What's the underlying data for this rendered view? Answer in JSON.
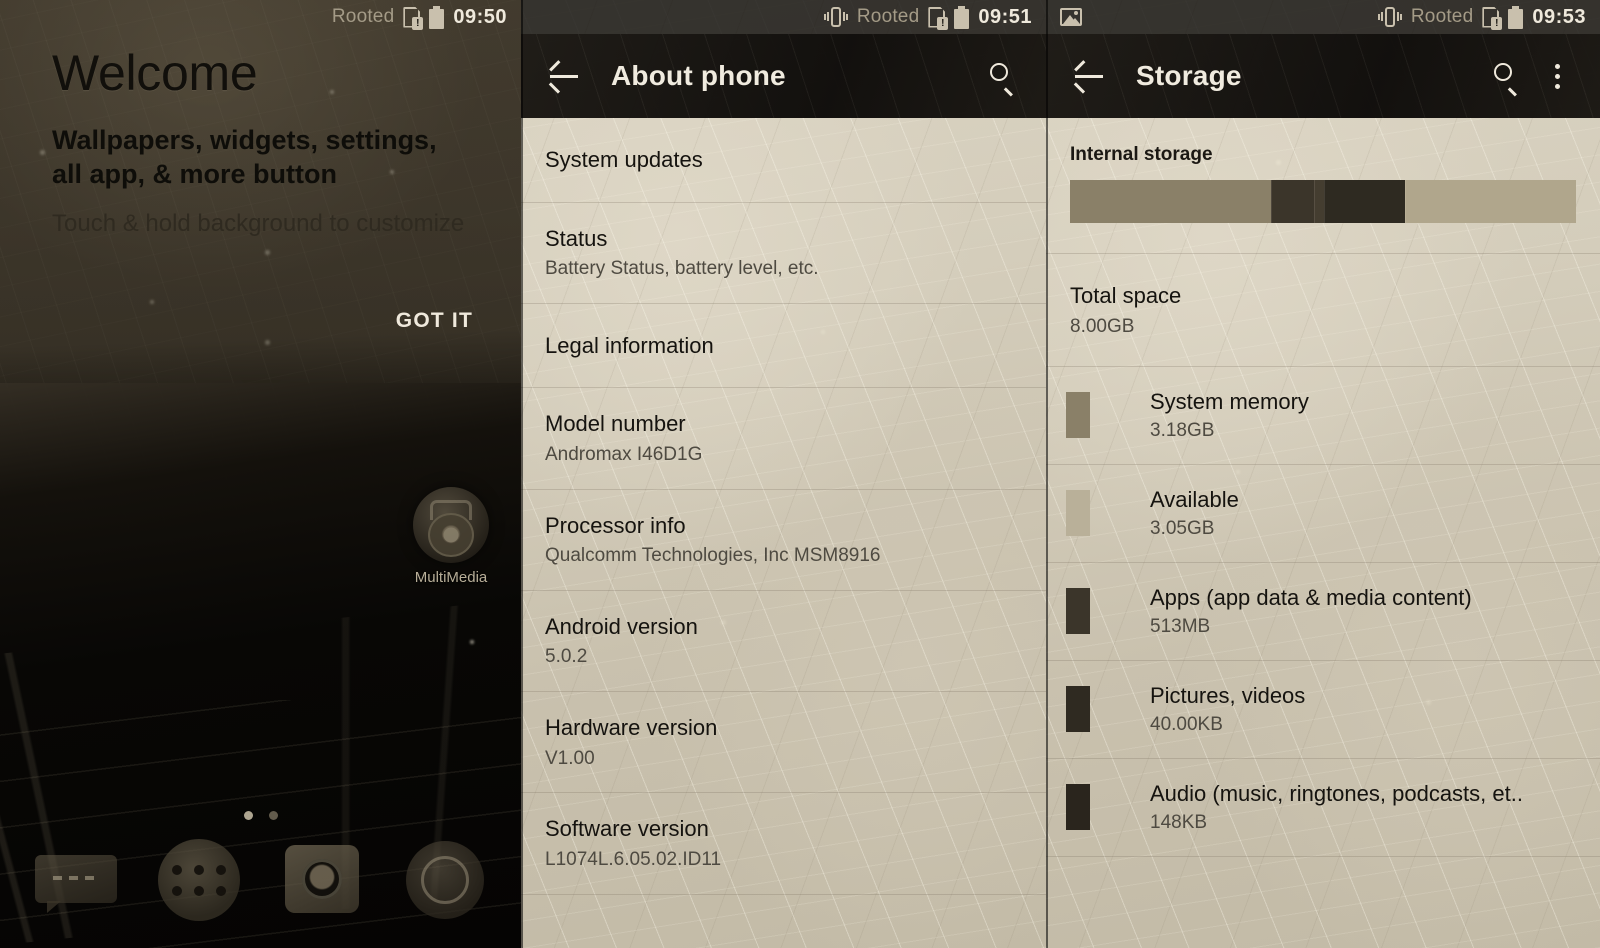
{
  "launcher": {
    "statusbar": {
      "rooted": "Rooted",
      "time": "09:50"
    },
    "welcome": {
      "title": "Welcome",
      "subtitle": "Wallpapers, widgets, settings,\nall app, & more button",
      "hint": "Touch & hold background to customize",
      "action": "GOT IT"
    },
    "app_icon": {
      "label": "MultiMedia"
    },
    "dock": {
      "items": [
        {
          "name": "messaging"
        },
        {
          "name": "all-apps"
        },
        {
          "name": "camera"
        },
        {
          "name": "browser"
        }
      ]
    },
    "page_dots": {
      "count": 2,
      "active": 1
    }
  },
  "about": {
    "statusbar": {
      "rooted": "Rooted",
      "time": "09:51"
    },
    "appbar": {
      "title": "About phone"
    },
    "rows": [
      {
        "title": "System updates",
        "subtitle": ""
      },
      {
        "title": "Status",
        "subtitle": "Battery Status, battery level, etc."
      },
      {
        "title": "Legal information",
        "subtitle": ""
      },
      {
        "title": "Model number",
        "subtitle": "Andromax I46D1G"
      },
      {
        "title": "Processor info",
        "subtitle": "Qualcomm Technologies, Inc MSM8916"
      },
      {
        "title": "Android version",
        "subtitle": "5.0.2"
      },
      {
        "title": "Hardware version",
        "subtitle": "V1.00"
      },
      {
        "title": "Software version",
        "subtitle": "L1074L.6.05.02.ID11"
      }
    ]
  },
  "storage": {
    "statusbar": {
      "rooted": "Rooted",
      "time": "09:53"
    },
    "appbar": {
      "title": "Storage"
    },
    "section_label": "Internal storage",
    "total": {
      "title": "Total space",
      "value": "8.00GB"
    },
    "bar_segments": [
      {
        "name": "system-memory",
        "color": "#8a8068",
        "pct": 39.8
      },
      {
        "name": "apps",
        "color": "#3b352a",
        "pct": 8.5
      },
      {
        "name": "pictures",
        "color": "#443d30",
        "pct": 2.0
      },
      {
        "name": "audio",
        "color": "#2e2a21",
        "pct": 16.0
      },
      {
        "name": "available",
        "color": "#b0a68c",
        "pct": 33.7
      }
    ],
    "items": [
      {
        "title": "System memory",
        "value": "3.18GB",
        "color": "#8a8068"
      },
      {
        "title": "Available",
        "value": "3.05GB",
        "color": "#b9b099"
      },
      {
        "title": "Apps (app data & media content)",
        "value": "513MB",
        "color": "#3b352a"
      },
      {
        "title": "Pictures, videos",
        "value": "40.00KB",
        "color": "#2f2a21"
      },
      {
        "title": "Audio (music, ringtones, podcasts, et..",
        "value": "148KB",
        "color": "#2a251d"
      }
    ]
  }
}
